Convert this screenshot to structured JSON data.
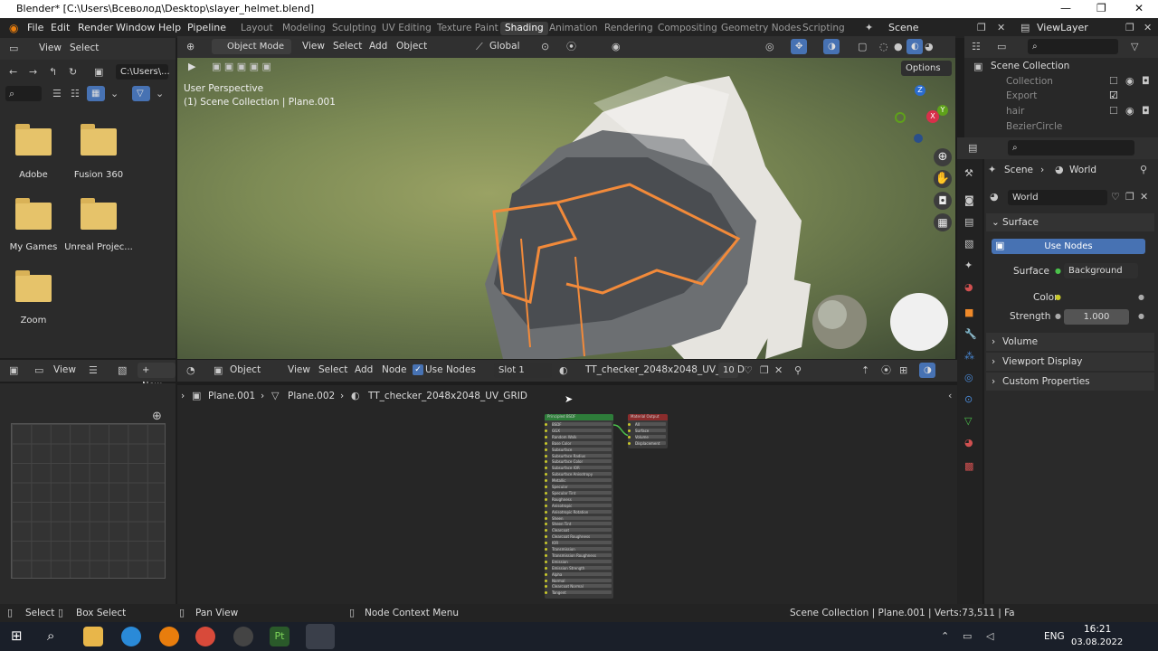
{
  "window": {
    "title": "Blender* [C:\\Users\\Всеволод\\Desktop\\slayer_helmet.blend]",
    "controls": [
      "—",
      "❐",
      "✕"
    ]
  },
  "topbar": {
    "menus": [
      "File",
      "Edit",
      "Render",
      "Window",
      "Help"
    ],
    "pipeline": "Pipeline",
    "workspaces": [
      "Layout",
      "Modeling",
      "Sculpting",
      "UV Editing",
      "Texture Paint",
      "Shading",
      "Animation",
      "Rendering",
      "Compositing",
      "Geometry Nodes",
      "Scripting"
    ],
    "active_workspace": "Shading",
    "scene": "Scene",
    "view_layer": "ViewLayer"
  },
  "file_browser": {
    "header": {
      "view": "View",
      "select": "Select",
      "path": "C:\\Users\\..."
    },
    "folders": [
      "Adobe",
      "Fusion 360",
      "My Games",
      "Unreal Projec...",
      "Zoom"
    ]
  },
  "viewport": {
    "header": {
      "mode": "Object Mode",
      "view": "View",
      "select": "Select",
      "add": "Add",
      "object": "Object",
      "orientation": "Global",
      "options": "Options"
    },
    "overlay_line1": "User Perspective",
    "overlay_line2": "(1) Scene Collection | Plane.001",
    "gizmo_axes": [
      "Z",
      "Y",
      "X"
    ]
  },
  "uv_editor": {
    "header": {
      "view": "View",
      "new": "New"
    }
  },
  "node_editor": {
    "header": {
      "type": "Object",
      "view": "View",
      "select": "Select",
      "add": "Add",
      "node": "Node",
      "use_nodes": "Use Nodes",
      "slot": "Slot 1",
      "material": "TT_checker_2048x2048_UV_GRID",
      "users": "10"
    },
    "breadcrumbs": [
      "Plane.001",
      "Plane.002",
      "TT_checker_2048x2048_UV_GRID"
    ],
    "bsdf_node": {
      "title": "Principled BSDF",
      "rows": [
        "BSDF",
        "GGX",
        "Random Walk",
        "Base Color",
        "Subsurface",
        "Subsurface Radius",
        "Subsurface Color",
        "Subsurface IOR",
        "Subsurface Anisotropy",
        "Metallic",
        "Specular",
        "Specular Tint",
        "Roughness",
        "Anisotropic",
        "Anisotropic Rotation",
        "Sheen",
        "Sheen Tint",
        "Clearcoat",
        "Clearcoat Roughness",
        "IOR",
        "Transmission",
        "Transmission Roughness",
        "Emission",
        "Emission Strength",
        "Alpha",
        "Normal",
        "Clearcoat Normal",
        "Tangent"
      ]
    },
    "output_node": {
      "title": "Material Output",
      "rows": [
        "All",
        "Surface",
        "Volume",
        "Displacement"
      ]
    }
  },
  "outliner": {
    "title": "Scene Collection",
    "items": [
      "Collection",
      "Export",
      "hair",
      "BezierCircle"
    ]
  },
  "properties": {
    "breadcrumb": {
      "scene": "Scene",
      "world": "World"
    },
    "world_name": "World",
    "surface_panel": "Surface",
    "use_nodes": "Use Nodes",
    "surface_label": "Surface",
    "surface_value": "Background",
    "color_label": "Color",
    "strength_label": "Strength",
    "strength_value": "1.000",
    "panels": [
      "Volume",
      "Viewport Display",
      "Custom Properties"
    ]
  },
  "statusbar": {
    "select": "Select",
    "box_select": "Box Select",
    "pan_view": "Pan View",
    "context_menu": "Node Context Menu",
    "stats": "Scene Collection | Plane.001 | Verts:73,511 | Fa"
  },
  "taskbar": {
    "language": "ENG",
    "time": "16:21",
    "date": "03.08.2022"
  },
  "colors": {
    "accent_blue": "#4772b3",
    "selection_orange": "#f28a3a",
    "bsdf_header": "#2e7d3a",
    "output_header": "#8a2c2c"
  }
}
